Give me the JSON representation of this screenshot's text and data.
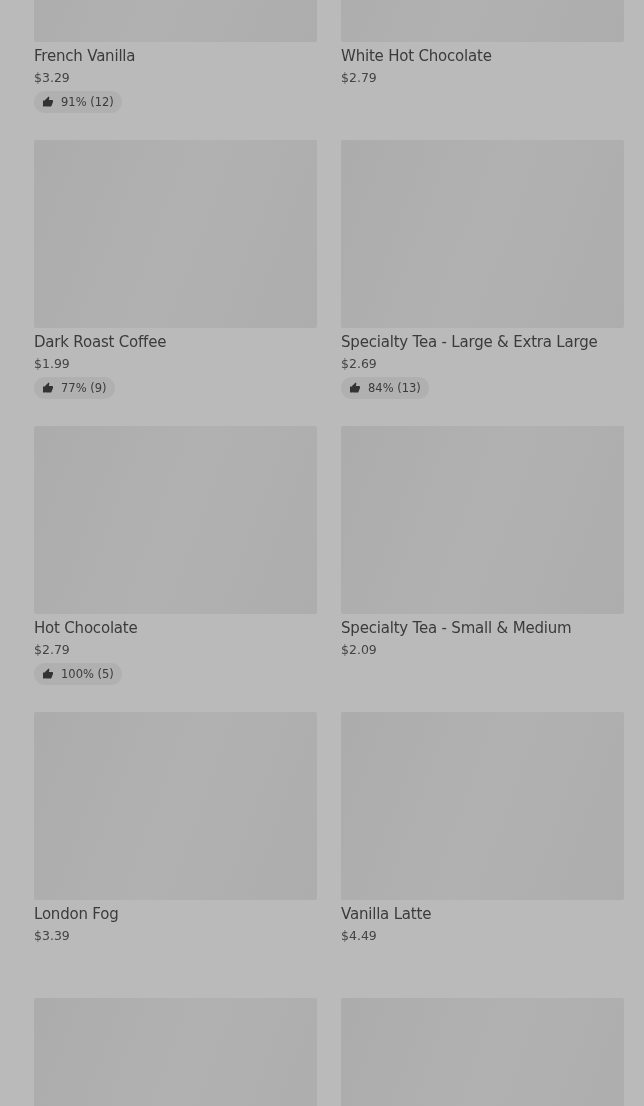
{
  "items": [
    {
      "kind": "product",
      "name": "French Vanilla",
      "price": "$3.29",
      "rating": "91% (12)"
    },
    {
      "kind": "product",
      "name": "White Hot Chocolate",
      "price": "$2.79"
    },
    {
      "kind": "product",
      "name": "Dark Roast Coffee",
      "price": "$1.99",
      "rating": "77% (9)"
    },
    {
      "kind": "product",
      "name": "Specialty Tea - Large & Extra Large",
      "price": "$2.69",
      "rating": "84% (13)"
    },
    {
      "kind": "product",
      "name": "Hot Chocolate",
      "price": "$2.79",
      "rating": "100% (5)"
    },
    {
      "kind": "product",
      "name": "Specialty Tea - Small & Medium",
      "price": "$2.09"
    },
    {
      "kind": "product",
      "name": "London Fog",
      "price": "$3.39"
    },
    {
      "kind": "product",
      "name": "Vanilla Latte",
      "price": "$4.49"
    },
    {
      "kind": "image_only"
    },
    {
      "kind": "image_only"
    }
  ]
}
